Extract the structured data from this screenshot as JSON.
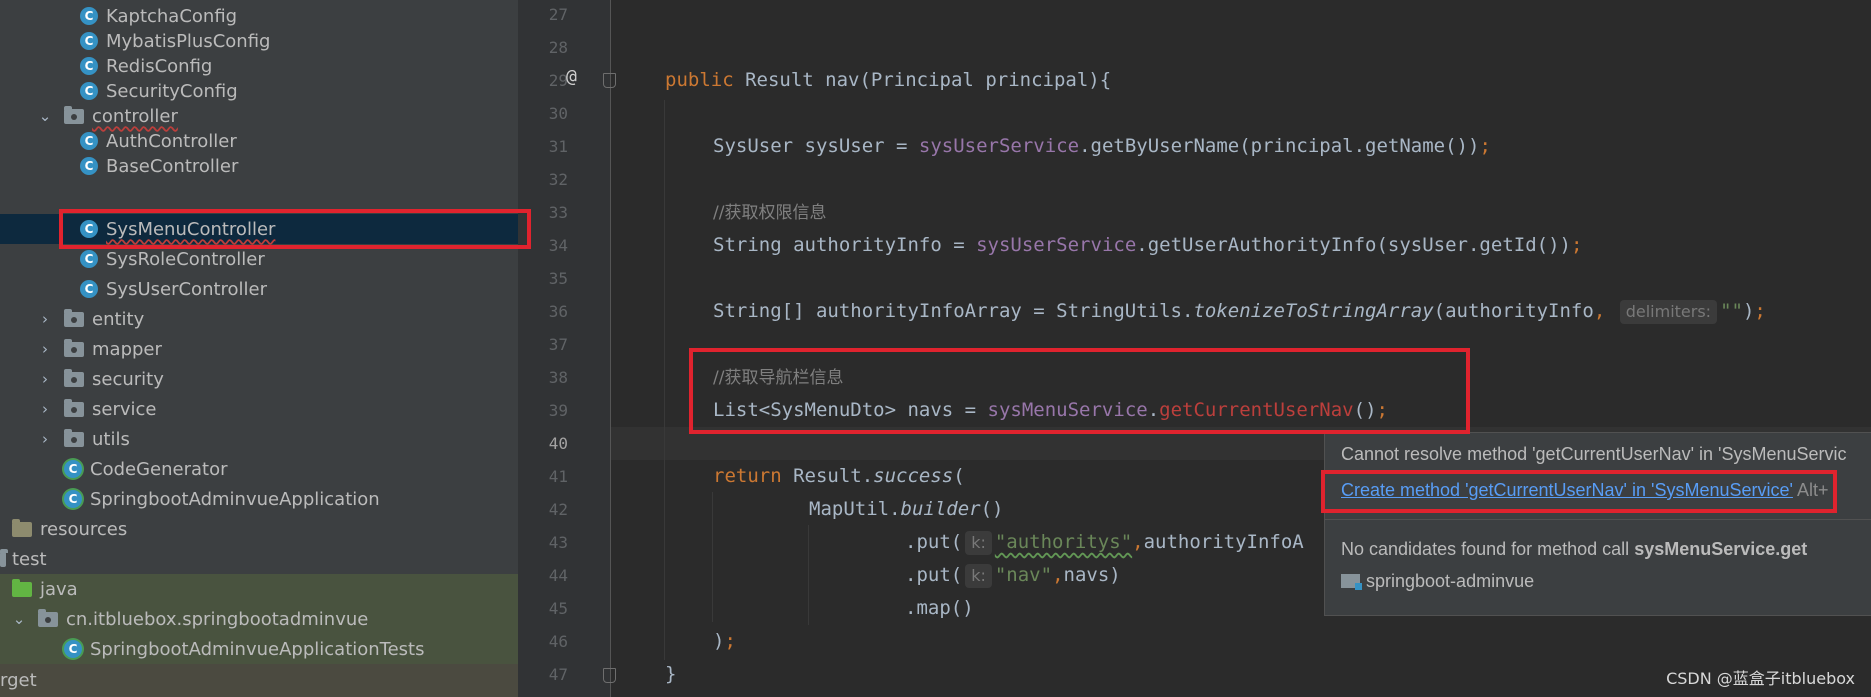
{
  "tree": {
    "items": [
      {
        "label": "KaptchaConfig"
      },
      {
        "label": "MybatisPlusConfig"
      },
      {
        "label": "RedisConfig"
      },
      {
        "label": "SecurityConfig"
      },
      {
        "label": "controller"
      },
      {
        "label": "AuthController"
      },
      {
        "label": "BaseController"
      },
      {
        "label": "SysMenuController"
      },
      {
        "label": "SysRoleController"
      },
      {
        "label": "SysUserController"
      },
      {
        "label": "entity"
      },
      {
        "label": "mapper"
      },
      {
        "label": "security"
      },
      {
        "label": "service"
      },
      {
        "label": "utils"
      },
      {
        "label": "CodeGenerator"
      },
      {
        "label": "SpringbootAdminvueApplication"
      },
      {
        "label": "resources"
      },
      {
        "label": "test"
      },
      {
        "label": "java"
      },
      {
        "label": "cn.itbluebox.springbootadminvue"
      },
      {
        "label": "SpringbootAdminvueApplicationTests"
      },
      {
        "label": "rget"
      }
    ],
    "icons": {
      "class": "C",
      "expanded": "⌄",
      "collapsed": "›"
    }
  },
  "gutter": {
    "line_numbers": [
      "27",
      "28",
      "29",
      "30",
      "31",
      "32",
      "33",
      "34",
      "35",
      "36",
      "37",
      "38",
      "39",
      "40",
      "41",
      "42",
      "43",
      "44",
      "45",
      "46",
      "47"
    ],
    "at_marker": "@"
  },
  "code": {
    "l29": {
      "kw": "public",
      "type": " Result ",
      "name": "nav",
      "rest": "(Principal principal){"
    },
    "l31": {
      "a": "SysUser sysUser = ",
      "svc": "sysUserService",
      "b": ".getByUserName(principal.getName())",
      "semi": ";"
    },
    "l33": {
      "comment": "//获取权限信息"
    },
    "l34": {
      "a": "String authorityInfo = ",
      "svc": "sysUserService",
      "b": ".getUserAuthorityInfo(sysUser.getId())",
      "semi": ";"
    },
    "l36": {
      "a": "String[] authorityInfoArray = StringUtils.",
      "method": "tokenizeToStringArray",
      "b": "(authorityInfo",
      "comma": ",",
      "hint": "delimiters:",
      "str": "\"\"",
      "end": ")",
      "semi": ";"
    },
    "l38": {
      "comment": "//获取导航栏信息"
    },
    "l39": {
      "a": "List<SysMenuDto> navs = ",
      "svc": "sysMenuService",
      "dot": ".",
      "err": "getCurrentUserNav",
      "b": "()",
      "semi": ";"
    },
    "l41": {
      "kw": "return",
      "a": " Result.",
      "method": "success",
      "b": "("
    },
    "l42": {
      "a": "MapUtil.",
      "method": "builder",
      "b": "()"
    },
    "l43": {
      "a": ".put(",
      "hint": "k:",
      "str": "\"authoritys\"",
      "comma": ",",
      "b": "authorityInfoA"
    },
    "l44": {
      "a": ".put(",
      "hint": "k:",
      "str": "\"nav\"",
      "comma": ",",
      "b": "navs)"
    },
    "l45": {
      "a": ".map()"
    },
    "l46": {
      "a": ")",
      "semi": ";"
    },
    "l47": {
      "a": "}"
    }
  },
  "popup": {
    "error_text": "Cannot resolve method 'getCurrentUserNav' in 'SysMenuServic",
    "create_link": "Create method 'getCurrentUserNav' in 'SysMenuService'",
    "shortcut": "Alt+",
    "no_candidates": "No candidates found for method call ",
    "no_candidates_bold": "sysMenuService.get",
    "module": "springboot-adminvue"
  },
  "watermark": "CSDN @蓝盒子itbluebox",
  "colors": {
    "annotation_red": "#e0232e",
    "link_blue": "#589df6",
    "selection": "#0d293e"
  }
}
